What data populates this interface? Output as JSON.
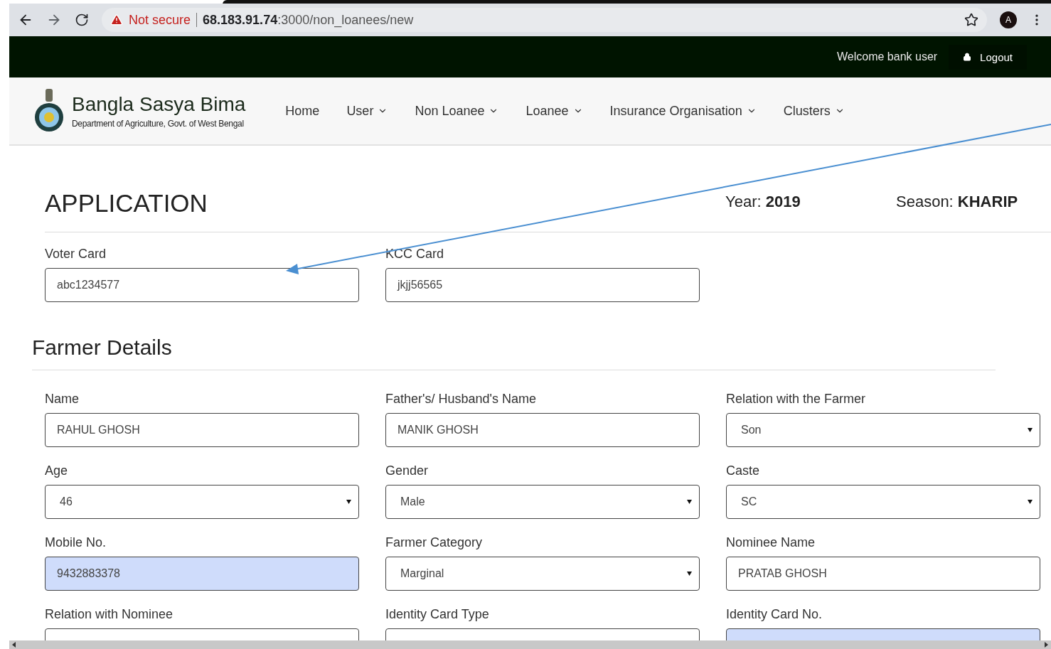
{
  "browser": {
    "security": "Not secure",
    "url_host": "68.183.91.74",
    "url_path": ":3000/non_loanees/new",
    "profile_initial": "A"
  },
  "top_bar": {
    "welcome": "Welcome bank user",
    "logout": "Logout"
  },
  "brand": {
    "title": "Bangla Sasya Bima",
    "subtitle": "Department of Agriculture, Govt. of West Bengal"
  },
  "nav": [
    {
      "label": "Home",
      "dropdown": false
    },
    {
      "label": "User",
      "dropdown": true
    },
    {
      "label": "Non Loanee",
      "dropdown": true
    },
    {
      "label": "Loanee",
      "dropdown": true
    },
    {
      "label": "Insurance Organisation",
      "dropdown": true
    },
    {
      "label": "Clusters",
      "dropdown": true
    }
  ],
  "application": {
    "title": "APPLICATION",
    "year": "Year: **2019**",
    "season": "Season: **KHARIP**"
  },
  "card_fields": [
    {
      "label": "Voter Card",
      "kind": "text",
      "value": "abc1234577",
      "autofilled": false
    },
    {
      "label": "KCC Card",
      "kind": "text",
      "value": "jkjj56565",
      "autofilled": false
    }
  ],
  "farmer_details": {
    "title": "Farmer Details",
    "fields": [
      {
        "label": "Name",
        "kind": "text",
        "value": "RAHUL GHOSH",
        "autofilled": false
      },
      {
        "label": "Father's/ Husband's Name",
        "kind": "text",
        "value": "MANIK GHOSH",
        "autofilled": false
      },
      {
        "label": "Relation with the Farmer",
        "kind": "select",
        "value": "Son",
        "autofilled": false
      },
      {
        "label": "Age",
        "kind": "select",
        "value": "46",
        "autofilled": false
      },
      {
        "label": "Gender",
        "kind": "select",
        "value": "Male",
        "autofilled": false
      },
      {
        "label": "Caste",
        "kind": "select",
        "value": "SC",
        "autofilled": false
      },
      {
        "label": "Mobile No.",
        "kind": "text",
        "value": "9432883378",
        "autofilled": true
      },
      {
        "label": "Farmer Category",
        "kind": "select",
        "value": "Marginal",
        "autofilled": false
      },
      {
        "label": "Nominee Name",
        "kind": "text",
        "value": "PRATAB GHOSH",
        "autofilled": false
      },
      {
        "label": "Relation with Nominee",
        "kind": "select",
        "autofilled": false
      },
      {
        "label": "Identity Card Type",
        "kind": "select",
        "autofilled": false
      },
      {
        "label": "Identity Card No.",
        "kind": "text",
        "autofilled": true
      }
    ]
  }
}
